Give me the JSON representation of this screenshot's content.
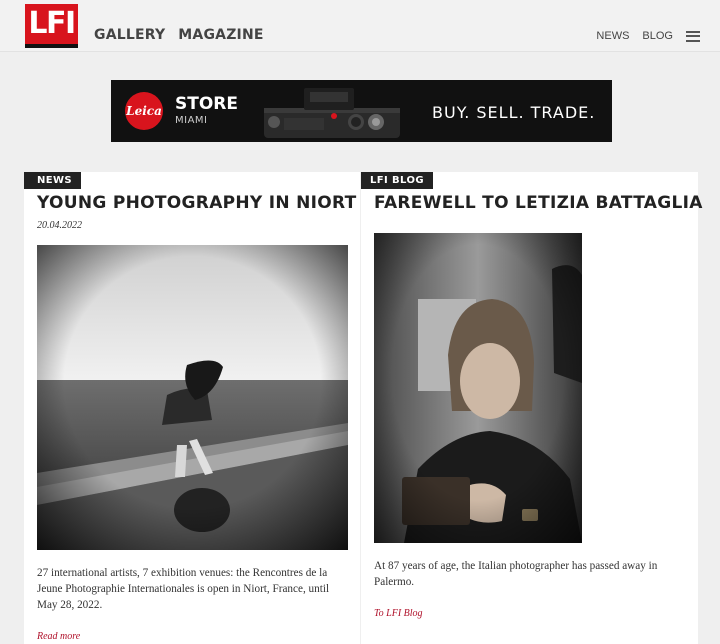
{
  "header": {
    "logo_text": "LFI",
    "nav_main": [
      "GALLERY",
      "MAGAZINE"
    ],
    "nav_right": [
      "NEWS",
      "BLOG"
    ],
    "menu_icon": "hamburger-menu-icon"
  },
  "banner": {
    "brand": "Leica",
    "title": "STORE",
    "subtitle": "MIAMI",
    "tagline": "BUY. SELL. TRADE."
  },
  "articles": [
    {
      "category": "NEWS",
      "title": "YOUNG PHOTOGRAPHY IN NIORT",
      "date": "20.04.2022",
      "excerpt": "27 international artists, 7 exhibition venues: the Rencontres de la Jeune Photographie Internationales is open in Niort, France, until May 28, 2022.",
      "link": "Read more"
    },
    {
      "category": "LFI BLOG",
      "title": "FAREWELL TO LETIZIA BATTAGLIA",
      "excerpt": "At 87 years of age, the Italian photographer has passed away in Palermo.",
      "link": "To LFI Blog"
    }
  ],
  "colors": {
    "brand_red": "#d8141d",
    "link_red": "#b0122b",
    "banner_bg": "#111111",
    "page_bg": "#efefef"
  }
}
